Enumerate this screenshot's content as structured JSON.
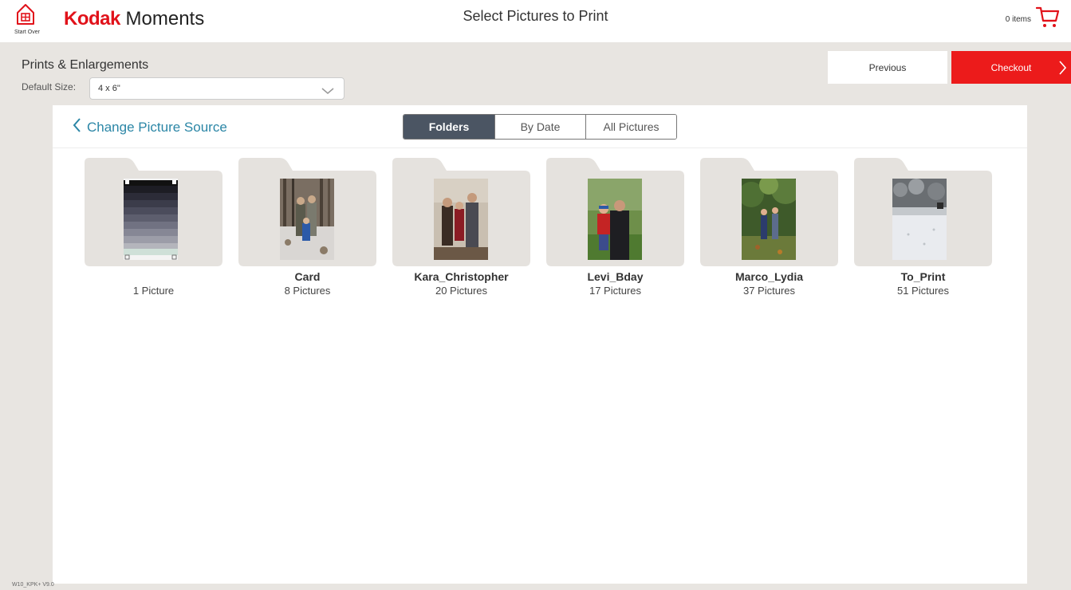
{
  "header": {
    "start_over_label": "Start Over",
    "brand_kodak": "Kodak",
    "brand_moments": "Moments",
    "page_title": "Select Pictures to Print",
    "cart_count": "0 items",
    "cart_icon": "shopping-cart-icon",
    "home_icon": "home-icon"
  },
  "product": {
    "title": "Prints & Enlargements",
    "size_label": "Default Size:",
    "size_value": "4 x 6\""
  },
  "nav": {
    "previous_label": "Previous",
    "checkout_label": "Checkout"
  },
  "source": {
    "change_label": "Change Picture Source",
    "tabs": [
      {
        "label": "Folders",
        "active": true
      },
      {
        "label": "By Date",
        "active": false
      },
      {
        "label": "All Pictures",
        "active": false
      }
    ]
  },
  "folders": [
    {
      "name": "",
      "count": "1 Picture"
    },
    {
      "name": "Card",
      "count": "8 Pictures"
    },
    {
      "name": "Kara_Christopher",
      "count": "20 Pictures"
    },
    {
      "name": "Levi_Bday",
      "count": "17 Pictures"
    },
    {
      "name": "Marco_Lydia",
      "count": "37 Pictures"
    },
    {
      "name": "To_Print",
      "count": "51 Pictures"
    }
  ],
  "footer": {
    "version": "W10_KPK+ V9.0"
  },
  "colors": {
    "brand_red": "#e1121a",
    "checkout_red": "#ec1b1b",
    "link_blue": "#2b86a6",
    "tab_active": "#4b5563"
  }
}
